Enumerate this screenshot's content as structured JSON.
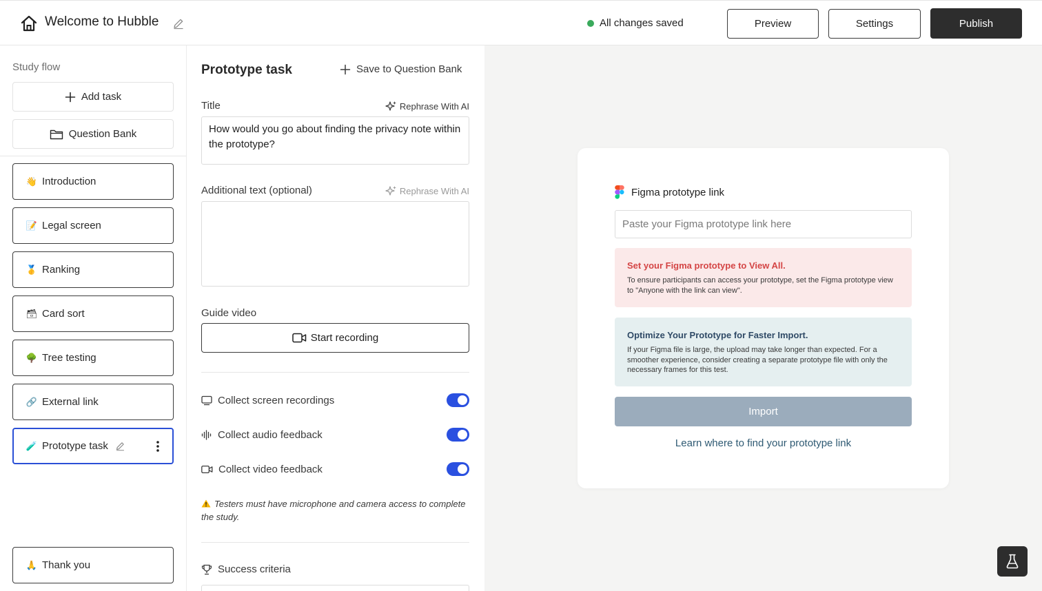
{
  "header": {
    "title": "Welcome to Hubble",
    "status": "All changes saved",
    "preview_label": "Preview",
    "settings_label": "Settings",
    "publish_label": "Publish",
    "status_color": "#3aaa5c"
  },
  "sidebar": {
    "heading": "Study flow",
    "add_task_label": "Add task",
    "question_bank_label": "Question Bank",
    "tasks": [
      {
        "emoji": "👋",
        "label": "Introduction"
      },
      {
        "emoji": "📝",
        "label": "Legal screen"
      },
      {
        "emoji": "🥇",
        "label": "Ranking"
      },
      {
        "emoji": "🗃",
        "label": "Card sort"
      },
      {
        "emoji": "🌳",
        "label": "Tree testing"
      },
      {
        "emoji": "🔗",
        "label": "External link"
      },
      {
        "emoji": "🧪",
        "label": "Prototype task"
      }
    ],
    "thank_you": {
      "emoji": "🙏",
      "label": "Thank you"
    },
    "active_color": "#2a4fd6"
  },
  "editor": {
    "title": "Prototype task",
    "save_bank_label": "Save to Question Bank",
    "title_label": "Title",
    "rephrase_label": "Rephrase With AI",
    "title_value": "How would you go about finding the privacy note within the prototype?",
    "additional_label": "Additional text (optional)",
    "additional_value": "",
    "guide_video_label": "Guide video",
    "start_recording_label": "Start recording",
    "toggles": [
      {
        "label": "Collect screen recordings",
        "on": true
      },
      {
        "label": "Collect audio feedback",
        "on": true
      },
      {
        "label": "Collect video feedback",
        "on": true
      }
    ],
    "warning": "Testers must have microphone and camera access to complete the study.",
    "success_label": "Success criteria",
    "toggle_color": "#2a50e0"
  },
  "preview": {
    "figma_heading": "Figma prototype link",
    "link_placeholder": "Paste your Figma prototype link here",
    "alert_red_title": "Set your Figma prototype to View All.",
    "alert_red_body": "To ensure participants can access your prototype, set the Figma prototype view to \"Anyone with the link can view\".",
    "alert_blue_title": "Optimize Your Prototype for Faster Import.",
    "alert_blue_body": "If your Figma file is large, the upload may take longer than expected. For a smoother experience, consider creating a separate prototype file with only the necessary frames for this test.",
    "import_label": "Import",
    "learn_link": "Learn where to find your prototype link"
  }
}
